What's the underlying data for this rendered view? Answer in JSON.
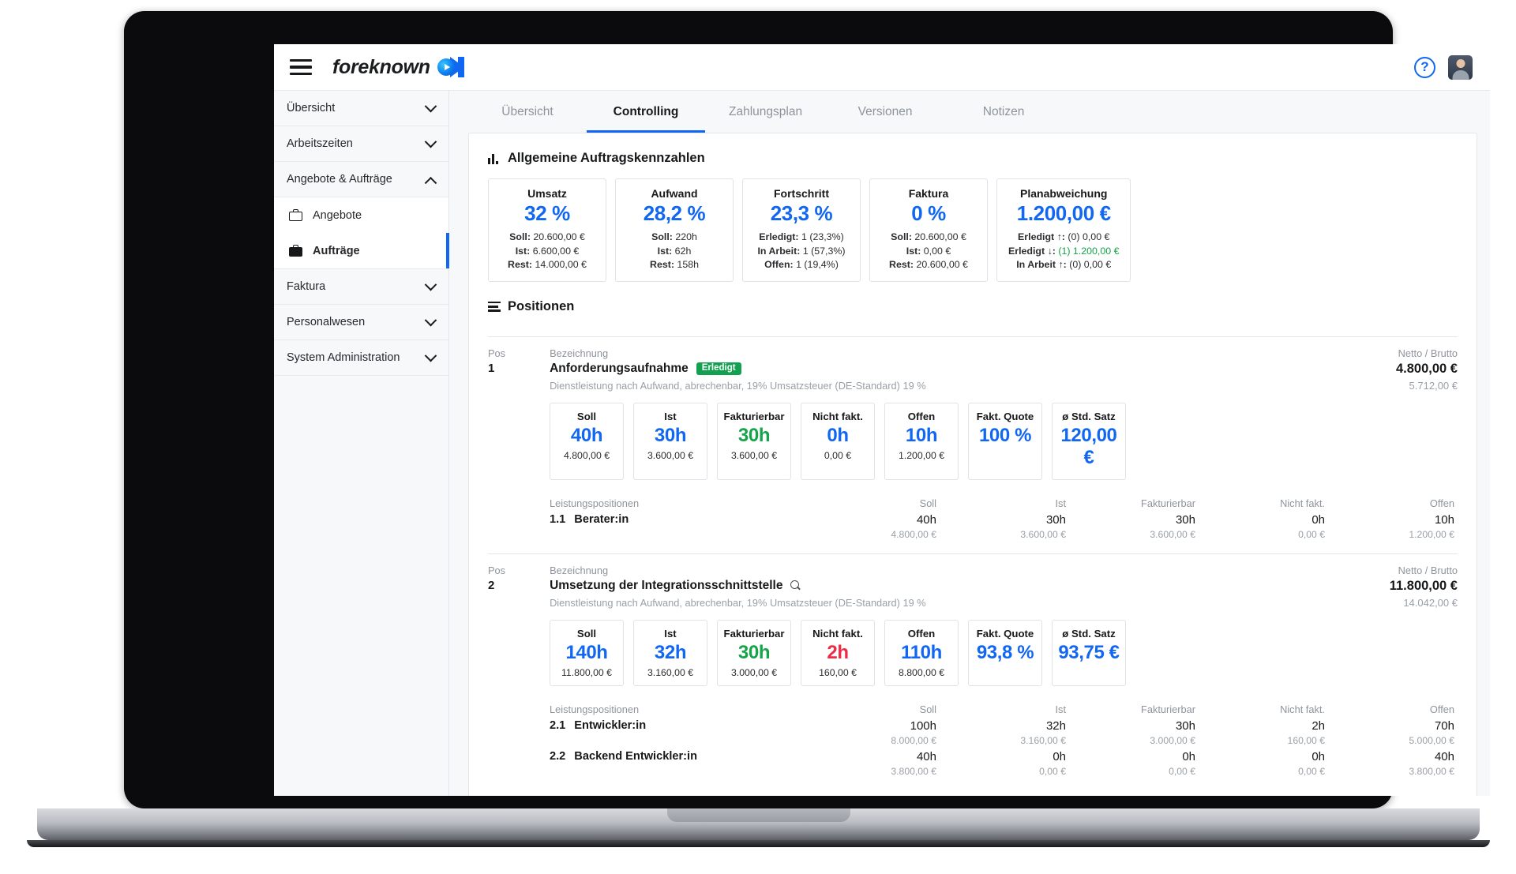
{
  "app": {
    "brand": "foreknown",
    "menu_icon": "hamburger-icon",
    "help_icon": "?",
    "avatar": "user-avatar"
  },
  "sidebar": {
    "groups": [
      {
        "label": "Übersicht",
        "state": "collapsed"
      },
      {
        "label": "Arbeitszeiten",
        "state": "collapsed"
      },
      {
        "label": "Angebote & Aufträge",
        "state": "expanded"
      }
    ],
    "subitems": [
      {
        "label": "Angebote",
        "icon": "briefcase-outline-icon",
        "active": false
      },
      {
        "label": "Aufträge",
        "icon": "briefcase-filled-icon",
        "active": true
      }
    ],
    "groups_after": [
      {
        "label": "Faktura",
        "state": "collapsed"
      },
      {
        "label": "Personalwesen",
        "state": "collapsed"
      },
      {
        "label": "System Administration",
        "state": "collapsed"
      }
    ]
  },
  "tabs": [
    {
      "label": "Übersicht",
      "active": false
    },
    {
      "label": "Controlling",
      "active": true
    },
    {
      "label": "Zahlungsplan",
      "active": false
    },
    {
      "label": "Versionen",
      "active": false
    },
    {
      "label": "Notizen",
      "active": false
    }
  ],
  "kpi_section": {
    "title": "Allgemeine Auftragskennzahlen",
    "icon": "bar-chart-icon",
    "cards": [
      {
        "label": "Umsatz",
        "value": "32 %",
        "lines": [
          {
            "key": "Soll:",
            "val": "20.600,00 €"
          },
          {
            "key": "Ist:",
            "val": "6.600,00 €"
          },
          {
            "key": "Rest:",
            "val": "14.000,00 €"
          }
        ]
      },
      {
        "label": "Aufwand",
        "value": "28,2 %",
        "lines": [
          {
            "key": "Soll:",
            "val": "220h"
          },
          {
            "key": "Ist:",
            "val": "62h"
          },
          {
            "key": "Rest:",
            "val": "158h"
          }
        ]
      },
      {
        "label": "Fortschritt",
        "value": "23,3 %",
        "lines": [
          {
            "key": "Erledigt:",
            "val": "1 (23,3%)"
          },
          {
            "key": "In Arbeit:",
            "val": "1 (57,3%)"
          },
          {
            "key": "Offen:",
            "val": "1 (19,4%)"
          }
        ]
      },
      {
        "label": "Faktura",
        "value": "0 %",
        "lines": [
          {
            "key": "Soll:",
            "val": "20.600,00 €"
          },
          {
            "key": "Ist:",
            "val": "0,00 €"
          },
          {
            "key": "Rest:",
            "val": "20.600,00 €"
          }
        ]
      },
      {
        "label": "Planabweichung",
        "value": "1.200,00 €",
        "lines": [
          {
            "key": "Erledigt ↑:",
            "val": "(0) 0,00 €"
          },
          {
            "key": "Erledigt ↓:",
            "val": "(1) 1.200,00 €",
            "color": "green"
          },
          {
            "key": "In Arbeit ↑:",
            "val": "(0) 0,00 €"
          }
        ]
      }
    ]
  },
  "positions_section": {
    "title": "Positionen",
    "icon": "list-icon",
    "col_pos": "Pos",
    "col_bezeichnung": "Bezeichnung",
    "col_netto_brutto": "Netto / Brutto",
    "lp_label": "Leistungspositionen",
    "lp_headers": [
      "Soll",
      "Ist",
      "Fakturierbar",
      "Nicht fakt.",
      "Offen"
    ],
    "positions": [
      {
        "num": "1",
        "title": "Anforderungsaufnahme",
        "badge": "Erledigt",
        "has_search_icon": false,
        "desc": "Dienstleistung nach Aufwand, abrechenbar, 19% Umsatzsteuer (DE-Standard) 19 %",
        "netto": "4.800,00 €",
        "brutto": "5.712,00 €",
        "metrics": [
          {
            "label": "Soll",
            "value": "40h",
            "money": "4.800,00 €",
            "color": "blue"
          },
          {
            "label": "Ist",
            "value": "30h",
            "money": "3.600,00 €",
            "color": "blue"
          },
          {
            "label": "Fakturierbar",
            "value": "30h",
            "money": "3.600,00 €",
            "color": "green"
          },
          {
            "label": "Nicht fakt.",
            "value": "0h",
            "money": "0,00 €",
            "color": "blue"
          },
          {
            "label": "Offen",
            "value": "10h",
            "money": "1.200,00 €",
            "color": "blue"
          },
          {
            "label": "Fakt. Quote",
            "value": "100 %",
            "money": "",
            "color": "blue"
          },
          {
            "label": "ø Std. Satz",
            "value": "120,00 €",
            "money": "",
            "color": "blue"
          }
        ],
        "lines": [
          {
            "num": "1.1",
            "name": "Berater:in",
            "hours": [
              "40h",
              "30h",
              "30h",
              "0h",
              "10h"
            ],
            "money": [
              "4.800,00 €",
              "3.600,00 €",
              "3.600,00 €",
              "0,00 €",
              "1.200,00 €"
            ]
          }
        ]
      },
      {
        "num": "2",
        "title": "Umsetzung der Integrationsschnittstelle",
        "badge": "",
        "has_search_icon": true,
        "desc": "Dienstleistung nach Aufwand, abrechenbar, 19% Umsatzsteuer (DE-Standard) 19 %",
        "netto": "11.800,00 €",
        "brutto": "14.042,00 €",
        "metrics": [
          {
            "label": "Soll",
            "value": "140h",
            "money": "11.800,00 €",
            "color": "blue"
          },
          {
            "label": "Ist",
            "value": "32h",
            "money": "3.160,00 €",
            "color": "blue"
          },
          {
            "label": "Fakturierbar",
            "value": "30h",
            "money": "3.000,00 €",
            "color": "green"
          },
          {
            "label": "Nicht fakt.",
            "value": "2h",
            "money": "160,00 €",
            "color": "red"
          },
          {
            "label": "Offen",
            "value": "110h",
            "money": "8.800,00 €",
            "color": "blue"
          },
          {
            "label": "Fakt. Quote",
            "value": "93,8 %",
            "money": "",
            "color": "blue"
          },
          {
            "label": "ø Std. Satz",
            "value": "93,75 €",
            "money": "",
            "color": "blue"
          }
        ],
        "lines": [
          {
            "num": "2.1",
            "name": "Entwickler:in",
            "hours": [
              "100h",
              "32h",
              "30h",
              "2h",
              "70h"
            ],
            "money": [
              "8.000,00 €",
              "3.160,00 €",
              "3.000,00 €",
              "160,00 €",
              "5.000,00 €"
            ]
          },
          {
            "num": "2.2",
            "name": "Backend Entwickler:in",
            "hours": [
              "40h",
              "0h",
              "0h",
              "0h",
              "40h"
            ],
            "money": [
              "3.800,00 €",
              "0,00 €",
              "0,00 €",
              "0,00 €",
              "3.800,00 €"
            ]
          }
        ]
      }
    ]
  },
  "colors": {
    "accent": "#1167f2",
    "green": "#16a34a",
    "red": "#ee2b45",
    "badge_green": "#12a150"
  }
}
